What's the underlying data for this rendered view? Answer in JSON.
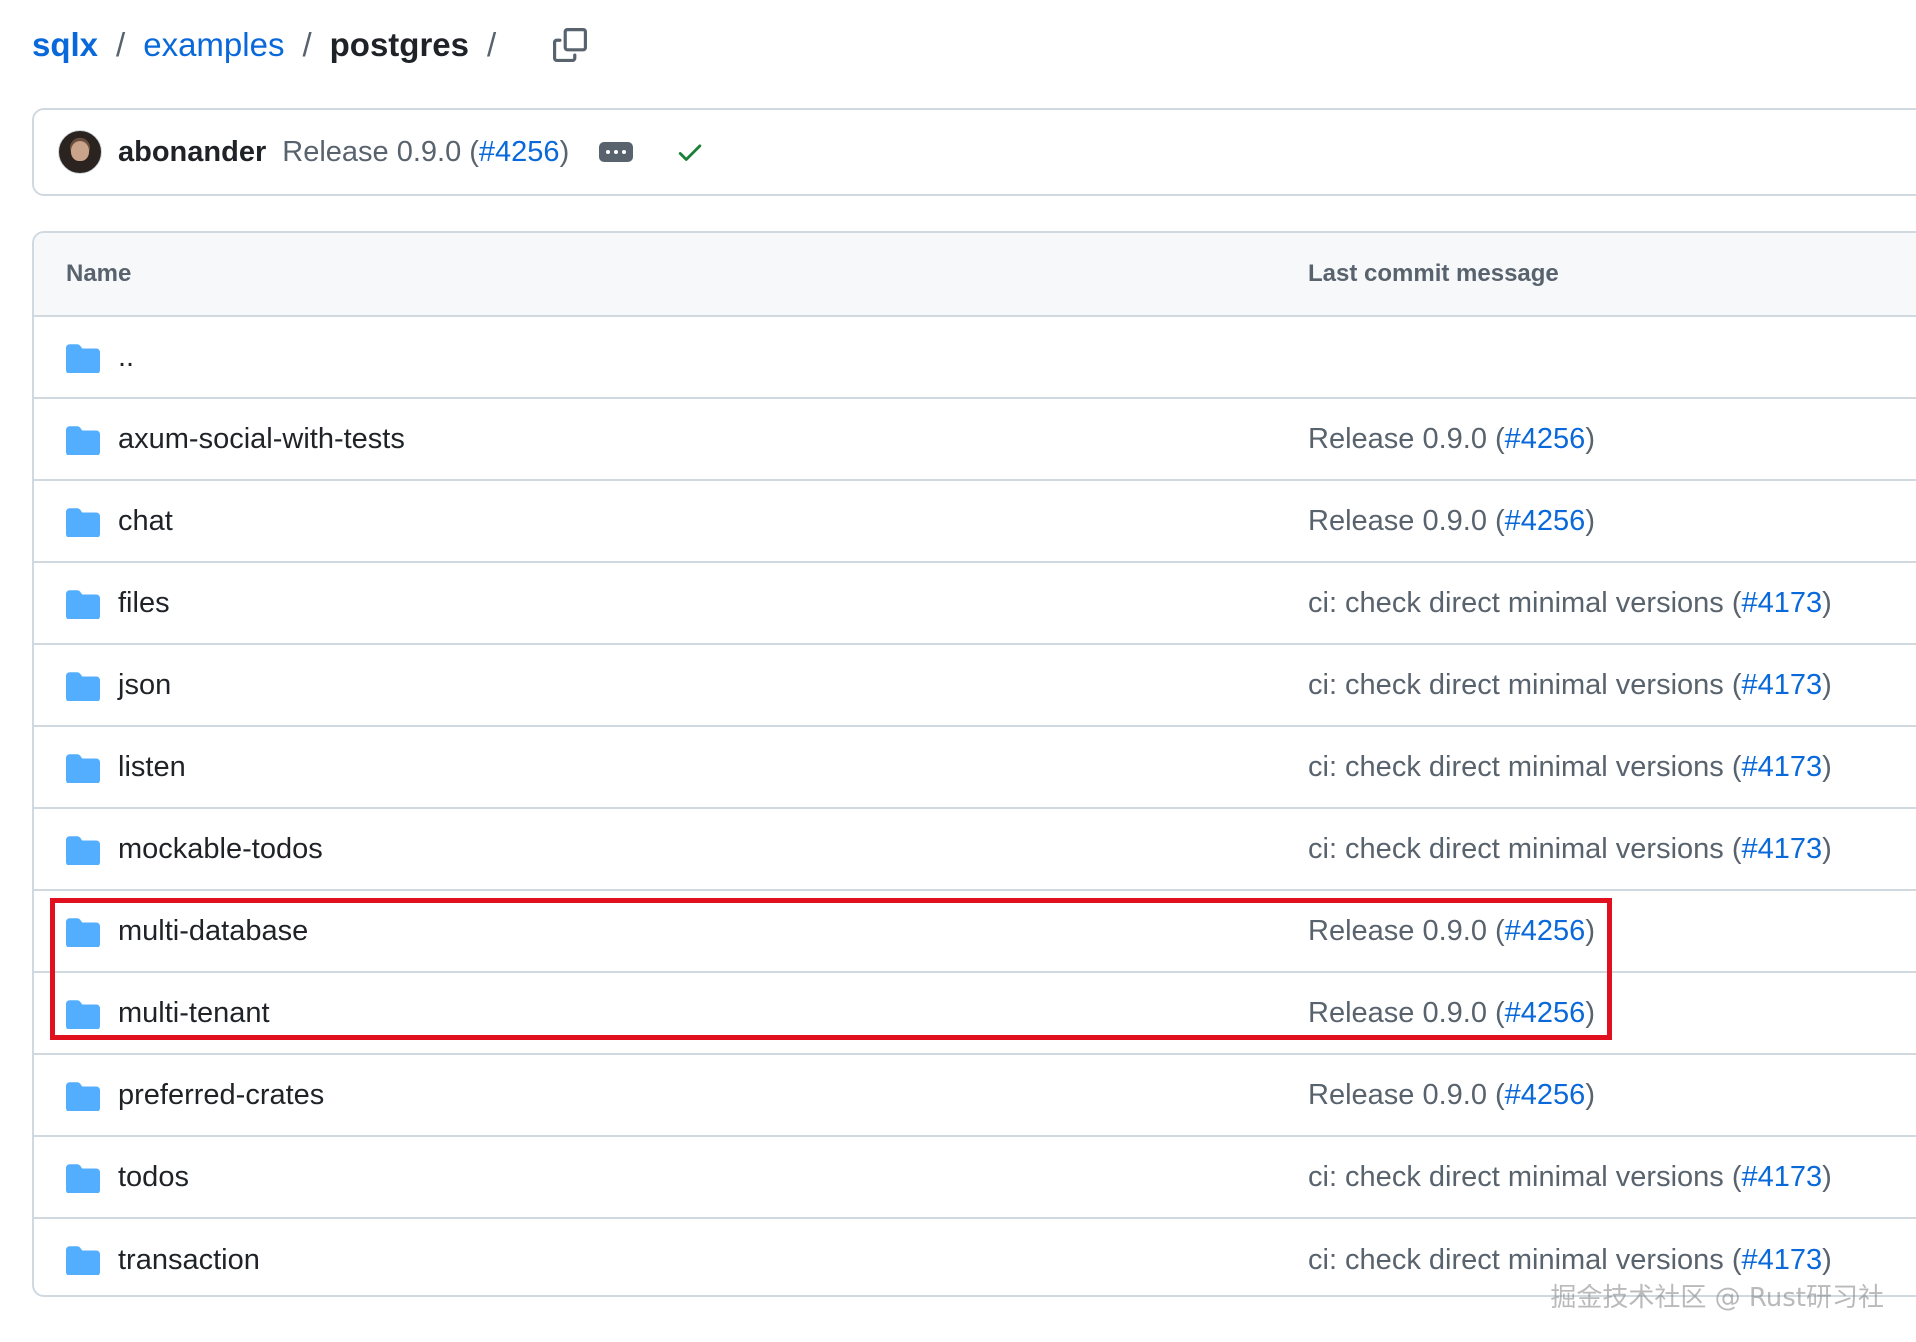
{
  "breadcrumb": {
    "repo": "sqlx",
    "folder": "examples",
    "current": "postgres",
    "separator": "/",
    "trailing_separator": "/",
    "copy_icon": "copy-icon"
  },
  "commit": {
    "author": "abonander",
    "message": "Release 0.9.0 (",
    "pr": "#4256",
    "message_end": ")",
    "status_icon": "check-icon",
    "status_color": "#1a7f37"
  },
  "table": {
    "columns": {
      "name": "Name",
      "last_commit": "Last commit message"
    },
    "rows": [
      {
        "name": "..",
        "msg": "",
        "pr": "",
        "end": ""
      },
      {
        "name": "axum-social-with-tests",
        "msg": "Release 0.9.0 (",
        "pr": "#4256",
        "end": ")"
      },
      {
        "name": "chat",
        "msg": "Release 0.9.0 (",
        "pr": "#4256",
        "end": ")"
      },
      {
        "name": "files",
        "msg": "ci: check direct minimal versions (",
        "pr": "#4173",
        "end": ")"
      },
      {
        "name": "json",
        "msg": "ci: check direct minimal versions (",
        "pr": "#4173",
        "end": ")"
      },
      {
        "name": "listen",
        "msg": "ci: check direct minimal versions (",
        "pr": "#4173",
        "end": ")"
      },
      {
        "name": "mockable-todos",
        "msg": "ci: check direct minimal versions (",
        "pr": "#4173",
        "end": ")"
      },
      {
        "name": "multi-database",
        "msg": "Release 0.9.0 (",
        "pr": "#4256",
        "end": ")"
      },
      {
        "name": "multi-tenant",
        "msg": "Release 0.9.0 (",
        "pr": "#4256",
        "end": ")"
      },
      {
        "name": "preferred-crates",
        "msg": "Release 0.9.0 (",
        "pr": "#4256",
        "end": ")"
      },
      {
        "name": "todos",
        "msg": "ci: check direct minimal versions (",
        "pr": "#4173",
        "end": ")"
      },
      {
        "name": "transaction",
        "msg": "ci: check direct minimal versions (",
        "pr": "#4173",
        "end": ")"
      }
    ]
  },
  "highlight": {
    "color": "#e0101f",
    "rows": [
      "multi-database",
      "multi-tenant"
    ]
  },
  "colors": {
    "link": "#0969da",
    "folder": "#54aeff",
    "border": "#d1d9e0"
  },
  "watermark": "掘金技术社区 @ Rust研习社"
}
